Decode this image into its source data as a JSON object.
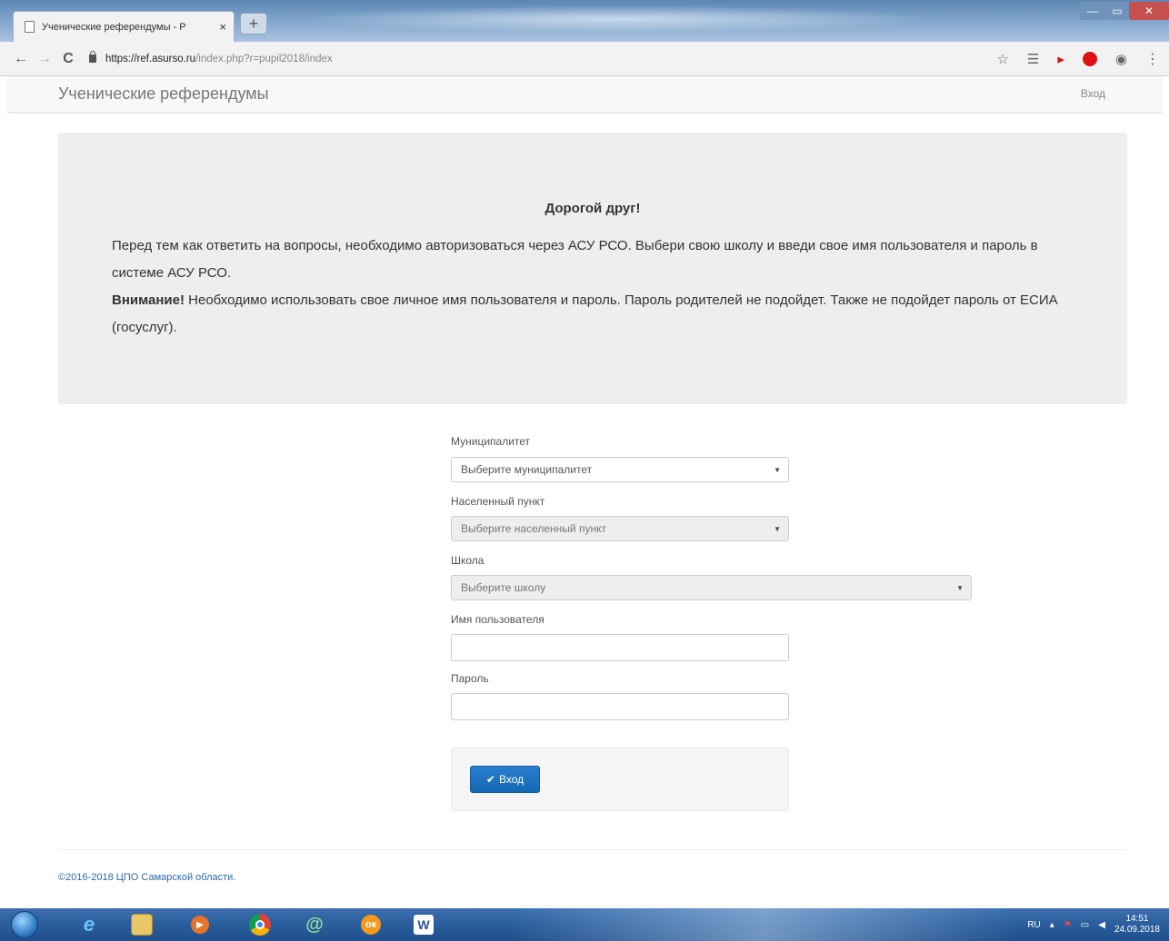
{
  "browser": {
    "tab_title": "Ученические референдумы - Р",
    "tab_close": "×",
    "new_tab": "+",
    "url_domain": "https://ref.asurso.ru",
    "url_path": "/index.php?r=pupil2018/index",
    "win_min": "—",
    "win_max": "▭",
    "win_close": "✕",
    "nav_back": "←",
    "nav_forward": "→",
    "nav_reload": "C",
    "star": "☆",
    "account": "◉",
    "menu": "⋮"
  },
  "navbar": {
    "brand": "Ученические референдумы",
    "login": "Вход"
  },
  "intro": {
    "heading": "Дорогой друг!",
    "text1": "Перед тем как ответить на вопросы, необходимо авторизоваться через АСУ РСО. Выбери свою школу и введи свое имя пользователя и пароль в системе АСУ РСО.",
    "attention_label": "Внимание!",
    "text2": " Необходимо использовать свое личное имя пользователя и пароль. Пароль родителей не подойдет. Также не подойдет пароль от ЕСИА (госуслуг)."
  },
  "form": {
    "municipality_label": "Муниципалитет",
    "municipality_value": "Выберите муниципалитет",
    "locality_label": "Населенный пункт",
    "locality_value": "Выберите населенный пункт",
    "school_label": "Школа",
    "school_value": "Выберите школу",
    "username_label": "Имя пользователя",
    "username_value": "",
    "password_label": "Пароль",
    "password_value": "",
    "caret": "▼",
    "submit_label": "Вход",
    "submit_check": "✔"
  },
  "footer": {
    "copyright": "©2016-2018 ЦПО Самарской области."
  },
  "taskbar": {
    "lang": "RU",
    "time": "14:51",
    "date": "24.09.2018",
    "apps": [
      "ie-icon",
      "explorer-icon",
      "media-player-icon",
      "chrome-icon",
      "mail-agent-icon",
      "odnoklassniki-icon",
      "word-icon"
    ]
  },
  "colors": {
    "accent_button": "#1467b3",
    "jumbotron_bg": "#eeeeee",
    "footer_link": "#2a6aad"
  }
}
